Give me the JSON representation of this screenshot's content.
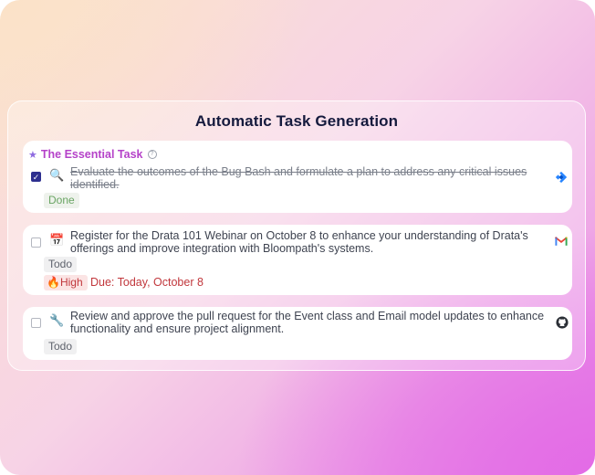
{
  "panel": {
    "title": "Automatic Task Generation"
  },
  "tasks": [
    {
      "section_title": "The Essential Task",
      "checked": true,
      "icon": "magnifier-icon",
      "text": "Evaluate the outcomes of the Bug Bash and formulate a plan to address any critical issues identified.",
      "status": "Done",
      "source": "jira-icon"
    },
    {
      "checked": false,
      "icon": "calendar-icon",
      "text": "Register for the Drata 101 Webinar on October 8 to enhance your understanding of Drata's offerings and improve integration with Bloompath's systems.",
      "status": "Todo",
      "priority": "High",
      "priority_icon": "fire-icon",
      "due": "Due: Today, October 8",
      "source": "gmail-icon"
    },
    {
      "checked": false,
      "icon": "wrench-icon",
      "text": "Review and approve the pull request for the Event class and Email model updates to enhance functionality and ensure project alignment.",
      "status": "Todo",
      "source": "github-icon"
    }
  ],
  "colors": {
    "accent_purple": "#b542c9",
    "checkbox_checked": "#2d2f8f",
    "done_green": "#6aa564",
    "high_red": "#c1373c"
  }
}
